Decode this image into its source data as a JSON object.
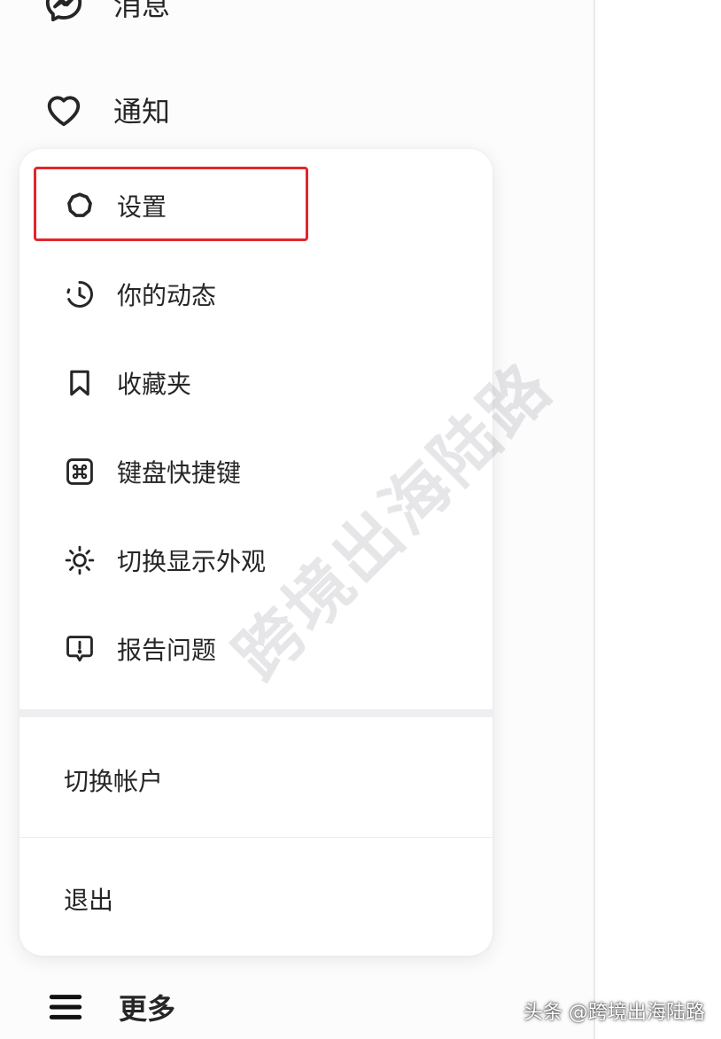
{
  "nav": {
    "messages": {
      "label": "消息",
      "icon": "messenger-icon"
    },
    "notifications": {
      "label": "通知",
      "icon": "heart-icon"
    },
    "more": {
      "label": "更多",
      "icon": "hamburger-menu-icon"
    }
  },
  "menu": {
    "items": [
      {
        "label": "设置",
        "icon": "gear-icon",
        "highlighted": true
      },
      {
        "label": "你的动态",
        "icon": "activity-clock-icon"
      },
      {
        "label": "收藏夹",
        "icon": "bookmark-icon"
      },
      {
        "label": "键盘快捷键",
        "icon": "command-key-icon"
      },
      {
        "label": "切换显示外观",
        "icon": "sun-icon"
      },
      {
        "label": "报告问题",
        "icon": "report-problem-icon"
      }
    ],
    "switch_account": "切换帐户",
    "logout": "退出"
  },
  "colors": {
    "highlight_border": "#e0272d",
    "text": "#262626"
  },
  "watermark": "跨境出海陆路",
  "credit": "头条 @跨境出海陆路"
}
